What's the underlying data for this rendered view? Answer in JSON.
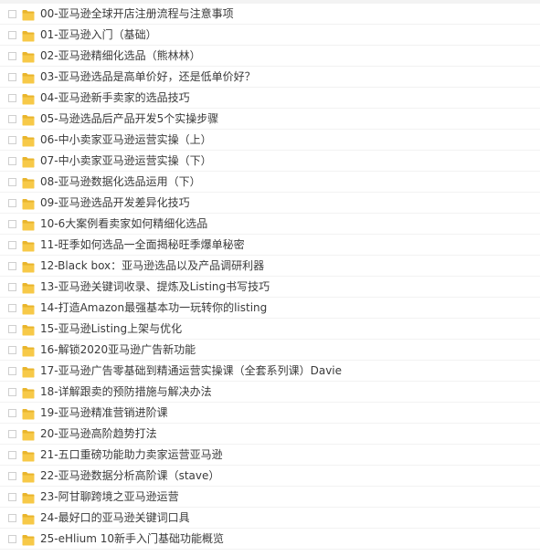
{
  "folder_color": "#f7c948",
  "folder_tab_color": "#e9b52d",
  "items": [
    {
      "name": "00-亚马逊全球开店注册流程与注意事项",
      "icon": "folder-icon"
    },
    {
      "name": "01-亚马逊入门（基础）",
      "icon": "folder-icon"
    },
    {
      "name": "02-亚马逊精细化选品（熊林林）",
      "icon": "folder-icon"
    },
    {
      "name": "03-亚马逊选品是高单价好，还是低单价好？",
      "icon": "folder-icon"
    },
    {
      "name": "04-亚马逊新手卖家的选品技巧",
      "icon": "folder-icon"
    },
    {
      "name": "05-马逊选品后产品开发5个实操步骤",
      "icon": "folder-icon"
    },
    {
      "name": "06-中小卖家亚马逊运营实操（上）",
      "icon": "folder-icon"
    },
    {
      "name": "07-中小卖家亚马逊运营实操（下）",
      "icon": "folder-icon"
    },
    {
      "name": "08-亚马逊数据化选品运用（下）",
      "icon": "folder-icon"
    },
    {
      "name": "09-亚马逊选品开发差异化技巧",
      "icon": "folder-icon"
    },
    {
      "name": "10-6大案例看卖家如何精细化选品",
      "icon": "folder-icon"
    },
    {
      "name": "11-旺季如何选品一全面揭秘旺季爆单秘密",
      "icon": "folder-icon"
    },
    {
      "name": "12-Black box：亚马逊选品以及产品调研利器",
      "icon": "folder-icon"
    },
    {
      "name": "13-亚马逊关键词收录、提炼及Listing书写技巧",
      "icon": "folder-icon"
    },
    {
      "name": "14-打造Amazon最强基本功一玩转你的listing",
      "icon": "folder-icon"
    },
    {
      "name": "15-亚马逊Listing上架与优化",
      "icon": "folder-icon"
    },
    {
      "name": "16-解锁2020亚马逊广告新功能",
      "icon": "folder-icon"
    },
    {
      "name": "17-亚马逊广告零基础到精通运营实操课（全套系列课）Davie",
      "icon": "folder-icon"
    },
    {
      "name": "18-详解跟卖的预防措施与解决办法",
      "icon": "folder-icon"
    },
    {
      "name": "19-亚马逊精准营销进阶课",
      "icon": "folder-icon"
    },
    {
      "name": "20-亚马逊高阶趋势打法",
      "icon": "folder-icon"
    },
    {
      "name": "21-五口重磅功能助力卖家运营亚马逊",
      "icon": "folder-icon"
    },
    {
      "name": "22-亚马逊数据分析高阶课（stave）",
      "icon": "folder-icon"
    },
    {
      "name": "23-阿甘聊跨境之亚马逊运营",
      "icon": "folder-icon"
    },
    {
      "name": "24-最好口的亚马逊关键词口具",
      "icon": "folder-icon"
    },
    {
      "name": "25-eHlium 10新手入门基础功能概览",
      "icon": "folder-icon"
    }
  ]
}
